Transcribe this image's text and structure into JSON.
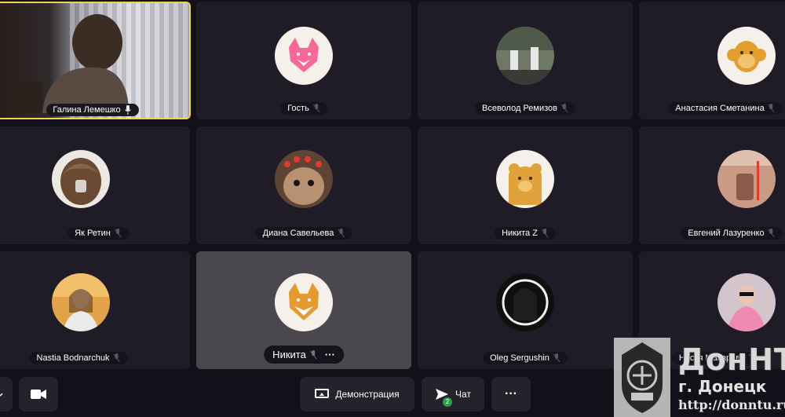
{
  "participants": [
    {
      "name": "Галина Лемешко",
      "mic": "on",
      "avatar": "video"
    },
    {
      "name": "Гость",
      "mic": "muted",
      "avatar": "fox-pink"
    },
    {
      "name": "Всеволод Ремизов",
      "mic": "muted",
      "avatar": "photo-hands"
    },
    {
      "name": "Анастасия Сметанина",
      "mic": "muted",
      "avatar": "monkey"
    },
    {
      "name": "Як Ретин",
      "mic": "muted",
      "avatar": "photo-yak"
    },
    {
      "name": "Диана Савельева",
      "mic": "muted",
      "avatar": "photo-hamster"
    },
    {
      "name": "Никита Z",
      "mic": "muted",
      "avatar": "bear"
    },
    {
      "name": "Евгений Лазуренко",
      "mic": "muted",
      "avatar": "photo-person"
    },
    {
      "name": "Nastia Bodnarchuk",
      "mic": "muted",
      "avatar": "photo-girl"
    },
    {
      "name": "Никита",
      "mic": "muted",
      "avatar": "fox-orange",
      "menu": "···"
    },
    {
      "name": "Oleg Sergushin",
      "mic": "muted",
      "avatar": "photo-dark"
    },
    {
      "name": "Настя Макарова",
      "mic": "muted",
      "avatar": "photo-pink"
    }
  ],
  "toolbar": {
    "screen_share_label": "Демонстрация",
    "chat_label": "Чат",
    "chat_badge": "2",
    "more_label": "···"
  },
  "watermark": {
    "title": "ДонНТУ",
    "city": "г. Донецк",
    "url": "http://donntu.ru"
  },
  "colors": {
    "background": "#121019",
    "tile": "#1f1c27",
    "active_border": "#f1d15a",
    "badge": "#2e9d4e"
  }
}
